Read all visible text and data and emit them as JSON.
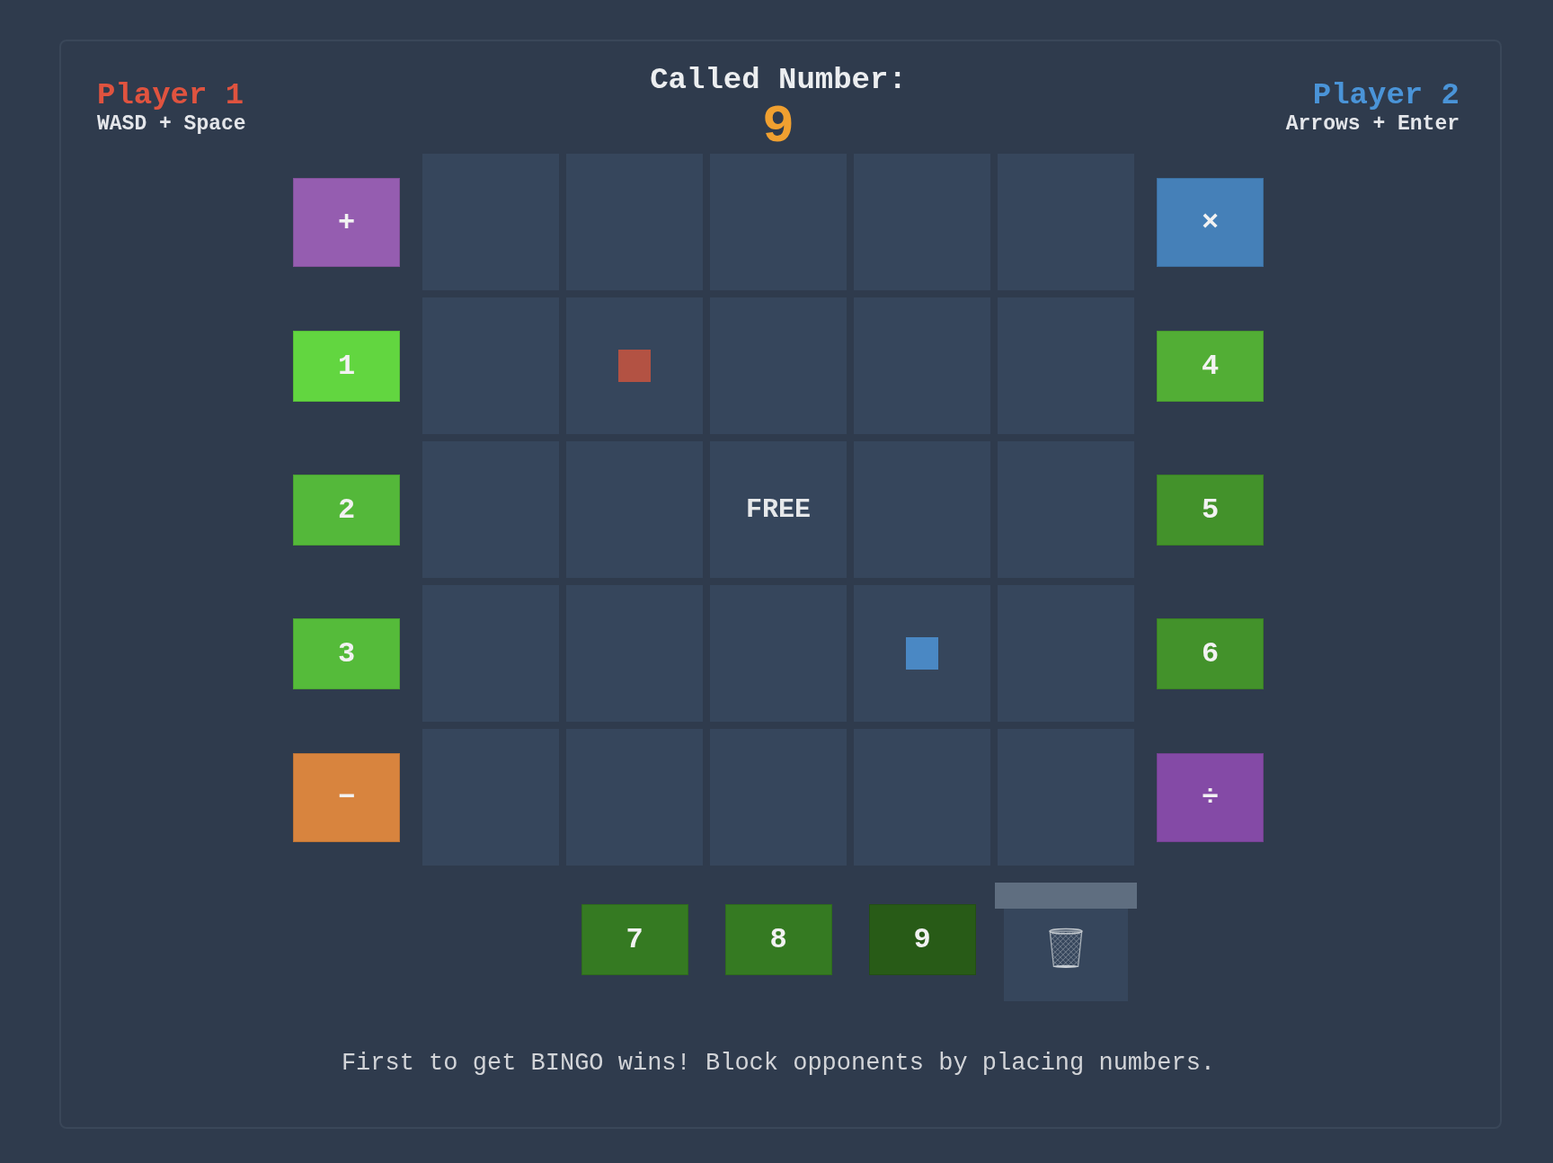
{
  "players": [
    {
      "name": "Player 1",
      "controls": "WASD + Space",
      "color": "#e0533f"
    },
    {
      "name": "Player 2",
      "controls": "Arrows + Enter",
      "color": "#4a94d8"
    }
  ],
  "called": {
    "label": "Called Number:",
    "number": "9"
  },
  "left_tiles": [
    {
      "label": "+",
      "kind": "operator",
      "color": "#955db0"
    },
    {
      "label": "1",
      "kind": "number",
      "color": "#62d640"
    },
    {
      "label": "2",
      "kind": "number",
      "color": "#54b83a"
    },
    {
      "label": "3",
      "kind": "number",
      "color": "#55bb3a"
    },
    {
      "label": "−",
      "kind": "operator",
      "color": "#d8843e"
    }
  ],
  "board": {
    "rows": [
      [
        {
          "cursor": false
        },
        {
          "cursor": false
        },
        {
          "cursor": false
        },
        {
          "cursor": false
        },
        {
          "cursor": false
        }
      ],
      [
        {
          "cursor": false
        },
        {
          "cursor": true,
          "color": "#b35243"
        },
        {
          "cursor": false
        },
        {
          "cursor": false
        },
        {
          "cursor": false
        }
      ],
      [
        {
          "cursor": false
        },
        {
          "cursor": false
        },
        {
          "label": "FREE",
          "cursor": false
        },
        {
          "cursor": false
        },
        {
          "cursor": false
        }
      ],
      [
        {
          "cursor": false
        },
        {
          "cursor": false
        },
        {
          "cursor": false
        },
        {
          "cursor": true,
          "color": "#4a88c4"
        },
        {
          "cursor": false
        }
      ],
      [
        {
          "cursor": false
        },
        {
          "cursor": false
        },
        {
          "cursor": false
        },
        {
          "cursor": false
        },
        {
          "cursor": false
        }
      ]
    ]
  },
  "right_tiles": [
    {
      "label": "×",
      "kind": "operator",
      "color": "#4580b8"
    },
    {
      "label": "4",
      "kind": "number",
      "color": "#52ae35"
    },
    {
      "label": "5",
      "kind": "number",
      "color": "#43922b"
    },
    {
      "label": "6",
      "kind": "number",
      "color": "#43922b"
    },
    {
      "label": "÷",
      "kind": "operator",
      "color": "#844aa6"
    }
  ],
  "tray_tiles": [
    {
      "label": "7",
      "kind": "number",
      "color": "#357a22"
    },
    {
      "label": "8",
      "kind": "number",
      "color": "#357a22"
    },
    {
      "label": "9",
      "kind": "number",
      "color": "#285b17"
    }
  ],
  "footer": "First to get BINGO wins! Block opponents by placing numbers."
}
